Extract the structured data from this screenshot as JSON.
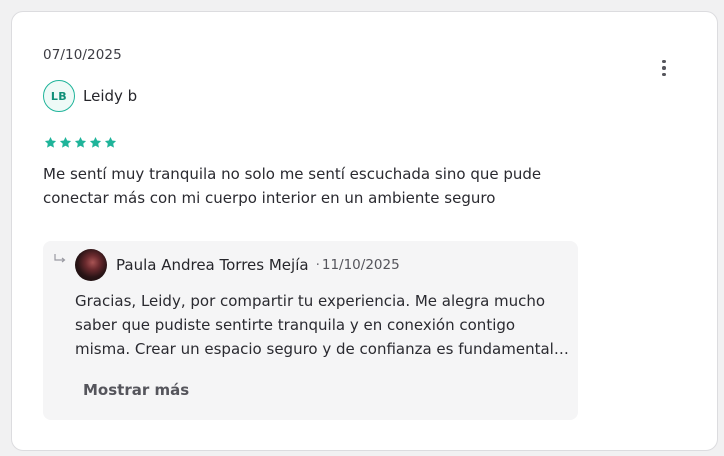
{
  "review": {
    "date": "07/10/2025",
    "menu_icon": "more-vertical-icon",
    "author": {
      "initials": "LB",
      "name": "Leidy b"
    },
    "rating": 5,
    "rating_color": "#1fb49a",
    "text_lines": [
      "Me sentí muy tranquila no solo me sentí escuchada sino que pude",
      "conectar más con mi cuerpo interior en un ambiente seguro"
    ]
  },
  "reply": {
    "icon": "reply-arrow-icon",
    "author": "Paula Andrea Torres Mejía",
    "separator": "·",
    "date": "11/10/2025",
    "text_lines": [
      "Gracias, Leidy, por compartir tu experiencia. Me alegra mucho",
      "saber que pudiste sentirte tranquila y en conexión contigo",
      "misma. Crear un espacio seguro y de confianza es fundamental…"
    ],
    "show_more_label": "Mostrar más"
  }
}
